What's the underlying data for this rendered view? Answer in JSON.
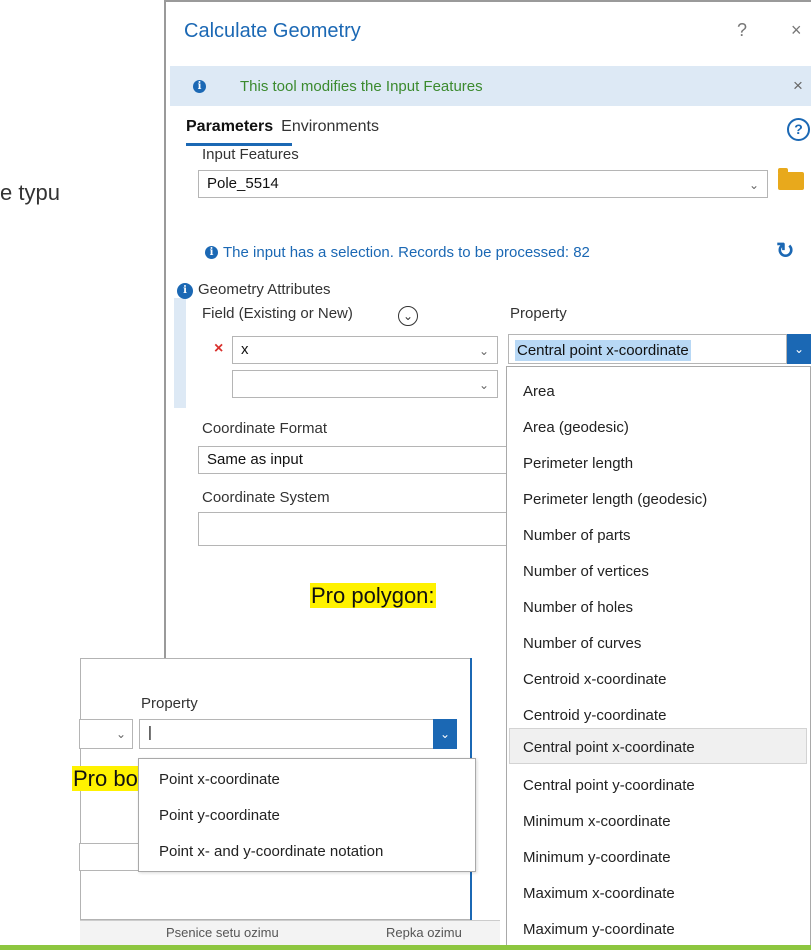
{
  "slide": {
    "partial_text": "e typu",
    "label_polygon": "Pro polygon:",
    "label_point": "Pro bod:"
  },
  "dialog": {
    "title": "Calculate Geometry",
    "help_btn": "?",
    "close_btn": "×",
    "info_bar_text": "This tool modifies the Input Features",
    "info_close": "×",
    "tabs": {
      "parameters": "Parameters",
      "environments": "Environments"
    },
    "help_circle": "?",
    "input_features": {
      "label": "Input Features",
      "value": "Pole_5514",
      "selection_note": "The input has a selection. Records to be processed: 82"
    },
    "geometry_attributes": {
      "label": "Geometry Attributes",
      "field_header": "Field (Existing or New)",
      "property_header": "Property",
      "row1_field": "x",
      "row1_property": "Central point x-coordinate",
      "row2_field": ""
    },
    "coordinate_format": {
      "label": "Coordinate Format",
      "value": "Same as input"
    },
    "coordinate_system": {
      "label": "Coordinate System",
      "value": ""
    }
  },
  "polygon_property_options": [
    "Area",
    "Area (geodesic)",
    "Perimeter length",
    "Perimeter length (geodesic)",
    "Number of parts",
    "Number of vertices",
    "Number of holes",
    "Number of curves",
    "Centroid x-coordinate",
    "Centroid y-coordinate",
    "Central point x-coordinate",
    "Central point y-coordinate",
    "Minimum x-coordinate",
    "Minimum y-coordinate",
    "Maximum x-coordinate",
    "Maximum y-coordinate"
  ],
  "hovered_option": "Central point x-coordinate",
  "inset": {
    "property_header": "Property",
    "property_value": "|",
    "point_property_options": [
      "Point x-coordinate",
      "Point y-coordinate",
      "Point x- and y-coordinate notation"
    ],
    "bottom_col1": "Psenice setu ozimu",
    "bottom_col2": "Repka ozimu"
  },
  "colors": {
    "accent": "#1b68b4",
    "info_bar": "#dde9f5",
    "info_text": "#3b8a2e",
    "highlight_yellow": "#fff200",
    "folder": "#e8a91c",
    "remove_x": "#d9302c",
    "footer_line": "#8dc63f"
  }
}
